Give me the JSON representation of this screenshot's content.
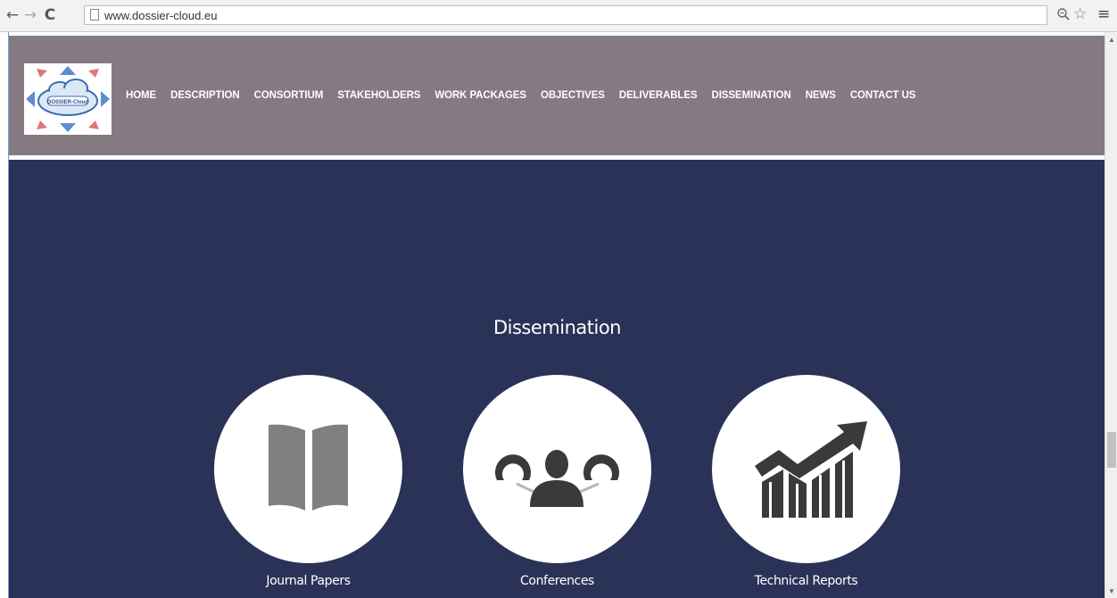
{
  "browser": {
    "url": "www.dossier-cloud.eu",
    "back_icon": "←",
    "forward_icon": "→",
    "reload_icon": "C",
    "zoom_icon": "🔍",
    "star_icon": "☆",
    "menu_icon": "≡"
  },
  "site": {
    "logo_text": "DOSSIER-Cloud",
    "nav": [
      "HOME",
      "DESCRIPTION",
      "CONSORTIUM",
      "STAKEHOLDERS",
      "WORK PACKAGES",
      "OBJECTIVES",
      "DELIVERABLES",
      "DISSEMINATION",
      "NEWS",
      "CONTACT US"
    ],
    "colors": {
      "header_bg": "#857982",
      "content_bg": "#2a3258"
    }
  },
  "section": {
    "title": "Dissemination",
    "cards": [
      {
        "label": "Journal Papers",
        "icon": "open-book-icon"
      },
      {
        "label": "Conferences",
        "icon": "people-network-icon"
      },
      {
        "label": "Technical Reports",
        "icon": "growth-chart-icon"
      }
    ]
  }
}
